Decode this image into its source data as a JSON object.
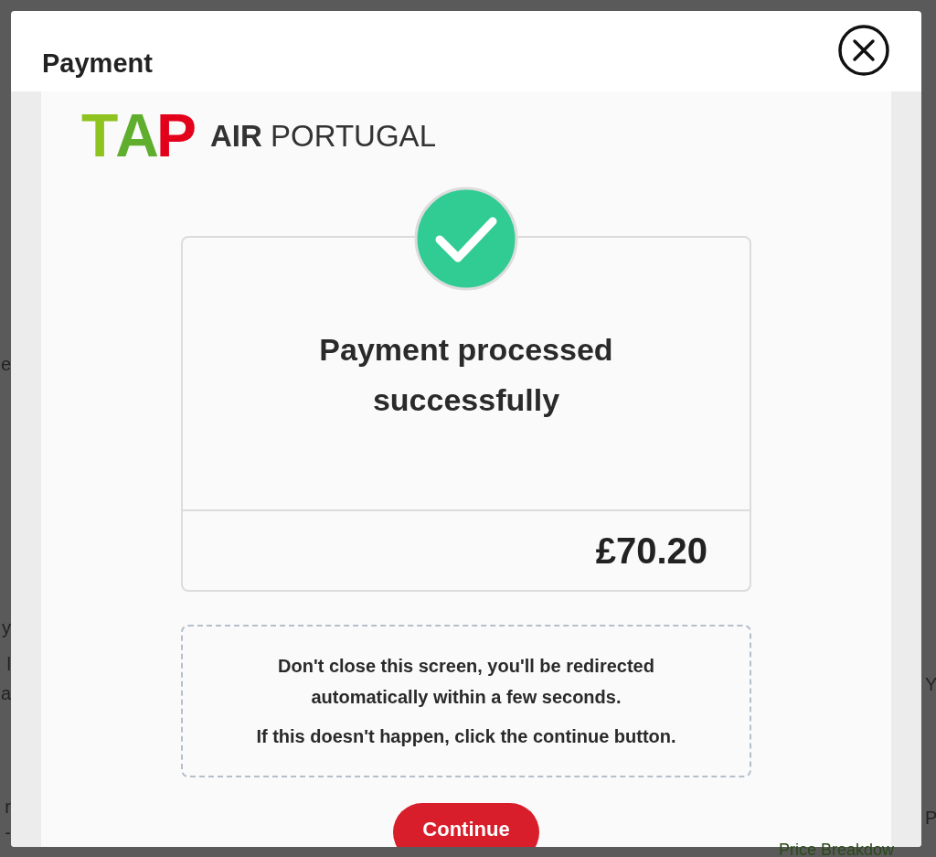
{
  "background_fragments": {
    "left": [
      "e",
      "y",
      "l",
      "a",
      "r",
      "-"
    ],
    "right": [
      "Y",
      "P",
      "Price Breakdow"
    ]
  },
  "modal": {
    "title": "Payment"
  },
  "logo": {
    "mark": [
      "T",
      "A",
      "P"
    ],
    "name": "**AIR** PORTUGAL"
  },
  "result": {
    "message": "Payment processed successfully",
    "amount": "£70.20"
  },
  "notice": [
    "Don't close this screen, you'll be redirected automatically within a few seconds.",
    "If this doesn't happen, click the continue button."
  ],
  "buttons": [
    "Continue"
  ]
}
